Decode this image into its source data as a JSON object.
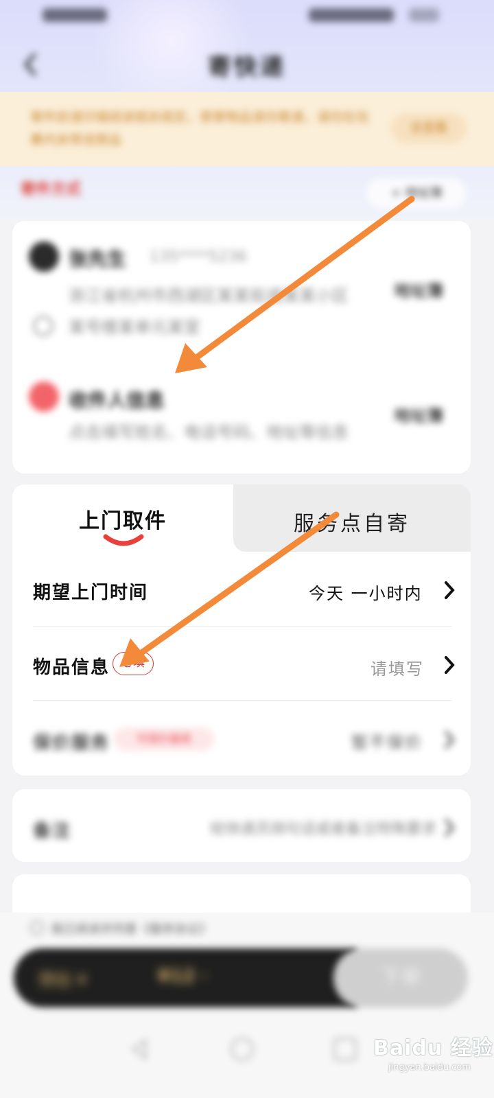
{
  "header": {
    "title": "寄快递",
    "back_icon": "chevron-left-icon"
  },
  "notice": {
    "text": "寄件前请仔细阅读相关规定，禁寄物品请勿寄递，请勿在包裹内夹带违禁品",
    "button": "去查看"
  },
  "address": {
    "section_label": "寄件方式",
    "book_button": "+ 地址簿",
    "sender": {
      "name": "张先生",
      "phone": "135****5236",
      "address": "浙江省杭州市西湖区某某街道某某小区某号楼某单元某室",
      "link": "地址簿"
    },
    "receiver": {
      "name": "收件人信息",
      "hint": "点击填写姓名、电话号码、地址等信息",
      "link": "地址簿"
    }
  },
  "tabs": [
    {
      "label": "上门取件",
      "active": true
    },
    {
      "label": "服务点自寄",
      "active": false
    }
  ],
  "rows": {
    "time": {
      "label": "期望上门时间",
      "value": "今天 一小时内"
    },
    "item": {
      "label": "物品信息",
      "badge": "必填",
      "value": "请填写"
    },
    "guarantee": {
      "label": "保价服务",
      "tag": "可保价最高",
      "value": "暂不保价"
    },
    "remark": {
      "label": "备注",
      "value": "给快递员捎句话或者备注特殊要求"
    }
  },
  "footer": {
    "agreement": "我已阅读并同意《服务协议》",
    "price_label": "预估 ¥",
    "price_value": "¥12 ·",
    "submit": "下单"
  },
  "watermark": {
    "text": "Baidu 经验",
    "sub": "jingyan.baidu.com"
  },
  "colors": {
    "accent_red": "#e0443d",
    "arrow_orange": "#f28a3a",
    "notice_bg": "#fbefd9"
  }
}
